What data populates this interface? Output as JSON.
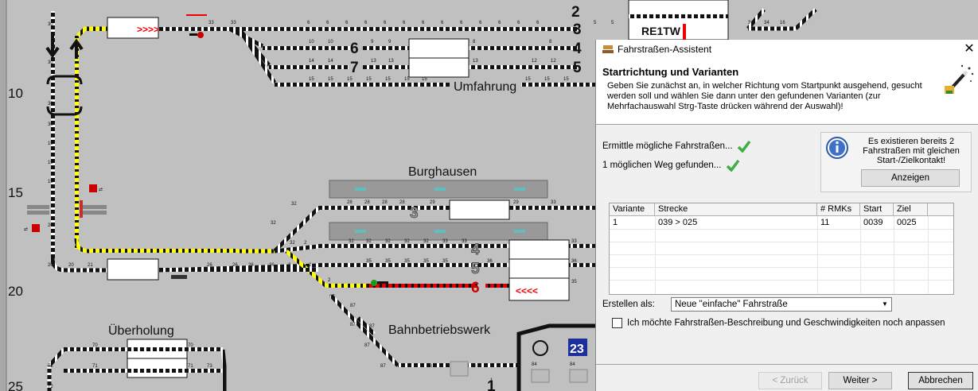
{
  "layout": {
    "row_numbers": [
      "10",
      "15",
      "20",
      "25"
    ],
    "station_names": {
      "umfahrung": "Umfahrung",
      "burghausen": "Burghausen",
      "ueberholung": "Überholung",
      "bahnbetriebswerk": "Bahnbetriebswerk"
    },
    "track_numbers": {
      "top_3": "3",
      "top_4": "4",
      "top_5": "5",
      "top_6": "6",
      "top_7": "7",
      "bh_3": "3",
      "bh_4": "4",
      "bh_5": "5",
      "bh_6": "6",
      "top_2": "2",
      "bottom_1": "1"
    },
    "signal_labels": {
      "train_right": ">>>>",
      "train_left": "<<<<",
      "train_box": "RE1TW"
    },
    "badge_23": "23",
    "segment_numbers": [
      "6",
      "6",
      "6",
      "6",
      "6",
      "6",
      "6",
      "6",
      "6",
      "6",
      "6",
      "6",
      "6",
      "5",
      "5",
      "34",
      "34",
      "16",
      "10",
      "10",
      "9",
      "9",
      "8",
      "8",
      "14",
      "14",
      "13",
      "13",
      "12",
      "12",
      "15",
      "15",
      "15",
      "15",
      "15",
      "15",
      "15",
      "15",
      "15",
      "15",
      "28",
      "28",
      "28",
      "29",
      "29",
      "32",
      "32",
      "32",
      "32",
      "32",
      "32",
      "33",
      "33",
      "33",
      "33",
      "26",
      "26",
      "26",
      "26",
      "2",
      "2",
      "35",
      "35",
      "35",
      "36",
      "36",
      "87",
      "87",
      "87",
      "87",
      "87",
      "83",
      "84",
      "84",
      "70",
      "70",
      "71",
      "71",
      "72",
      "72",
      "73",
      "20",
      "20",
      "21",
      "19",
      "19",
      "19",
      "30",
      "30",
      "30",
      "31",
      "30",
      "16"
    ]
  },
  "dialog": {
    "title": "Fahrstraßen-Assistent",
    "close_label": "✕",
    "heading": "Startrichtung und Varianten",
    "description": "Geben Sie zunächst an, in welcher Richtung vom Startpunkt ausgehend, gesucht werden soll und wählen Sie dann unter den gefundenen Varianten (zur Mehrfachauswahl Strg-Taste drücken während der Auswahl)!",
    "status_1": "Ermittle mögliche Fahrstraßen...",
    "status_2": "1 möglichen Weg gefunden...",
    "info_text": "Es existieren bereits 2 Fahrstraßen mit gleichen Start-/Zielkontakt!",
    "show_button": "Anzeigen",
    "table": {
      "columns": [
        "Variante",
        "Strecke",
        "# RMKs",
        "Start",
        "Ziel"
      ],
      "rows": [
        {
          "variante": "1",
          "strecke": "039 > 025",
          "rmks": "11",
          "start": "0039",
          "ziel": "0025"
        }
      ]
    },
    "create_as_label": "Erstellen als:",
    "create_as_value": "Neue \"einfache\" Fahrstraße",
    "checkbox_label": "Ich möchte Fahrstraßen-Beschreibung und Geschwindigkeiten noch anpassen",
    "checkbox_checked": false,
    "back_button": "< Zurück",
    "next_button": "Weiter >",
    "cancel_button": "Abbrechen"
  },
  "colors": {
    "background": "#c0c0c0",
    "active_route": "#ffff00",
    "occupied": "#ff0000",
    "dialog_bg": "#f0f0f0",
    "check_green": "#3cb043",
    "badge_blue": "#1c2f9c"
  }
}
